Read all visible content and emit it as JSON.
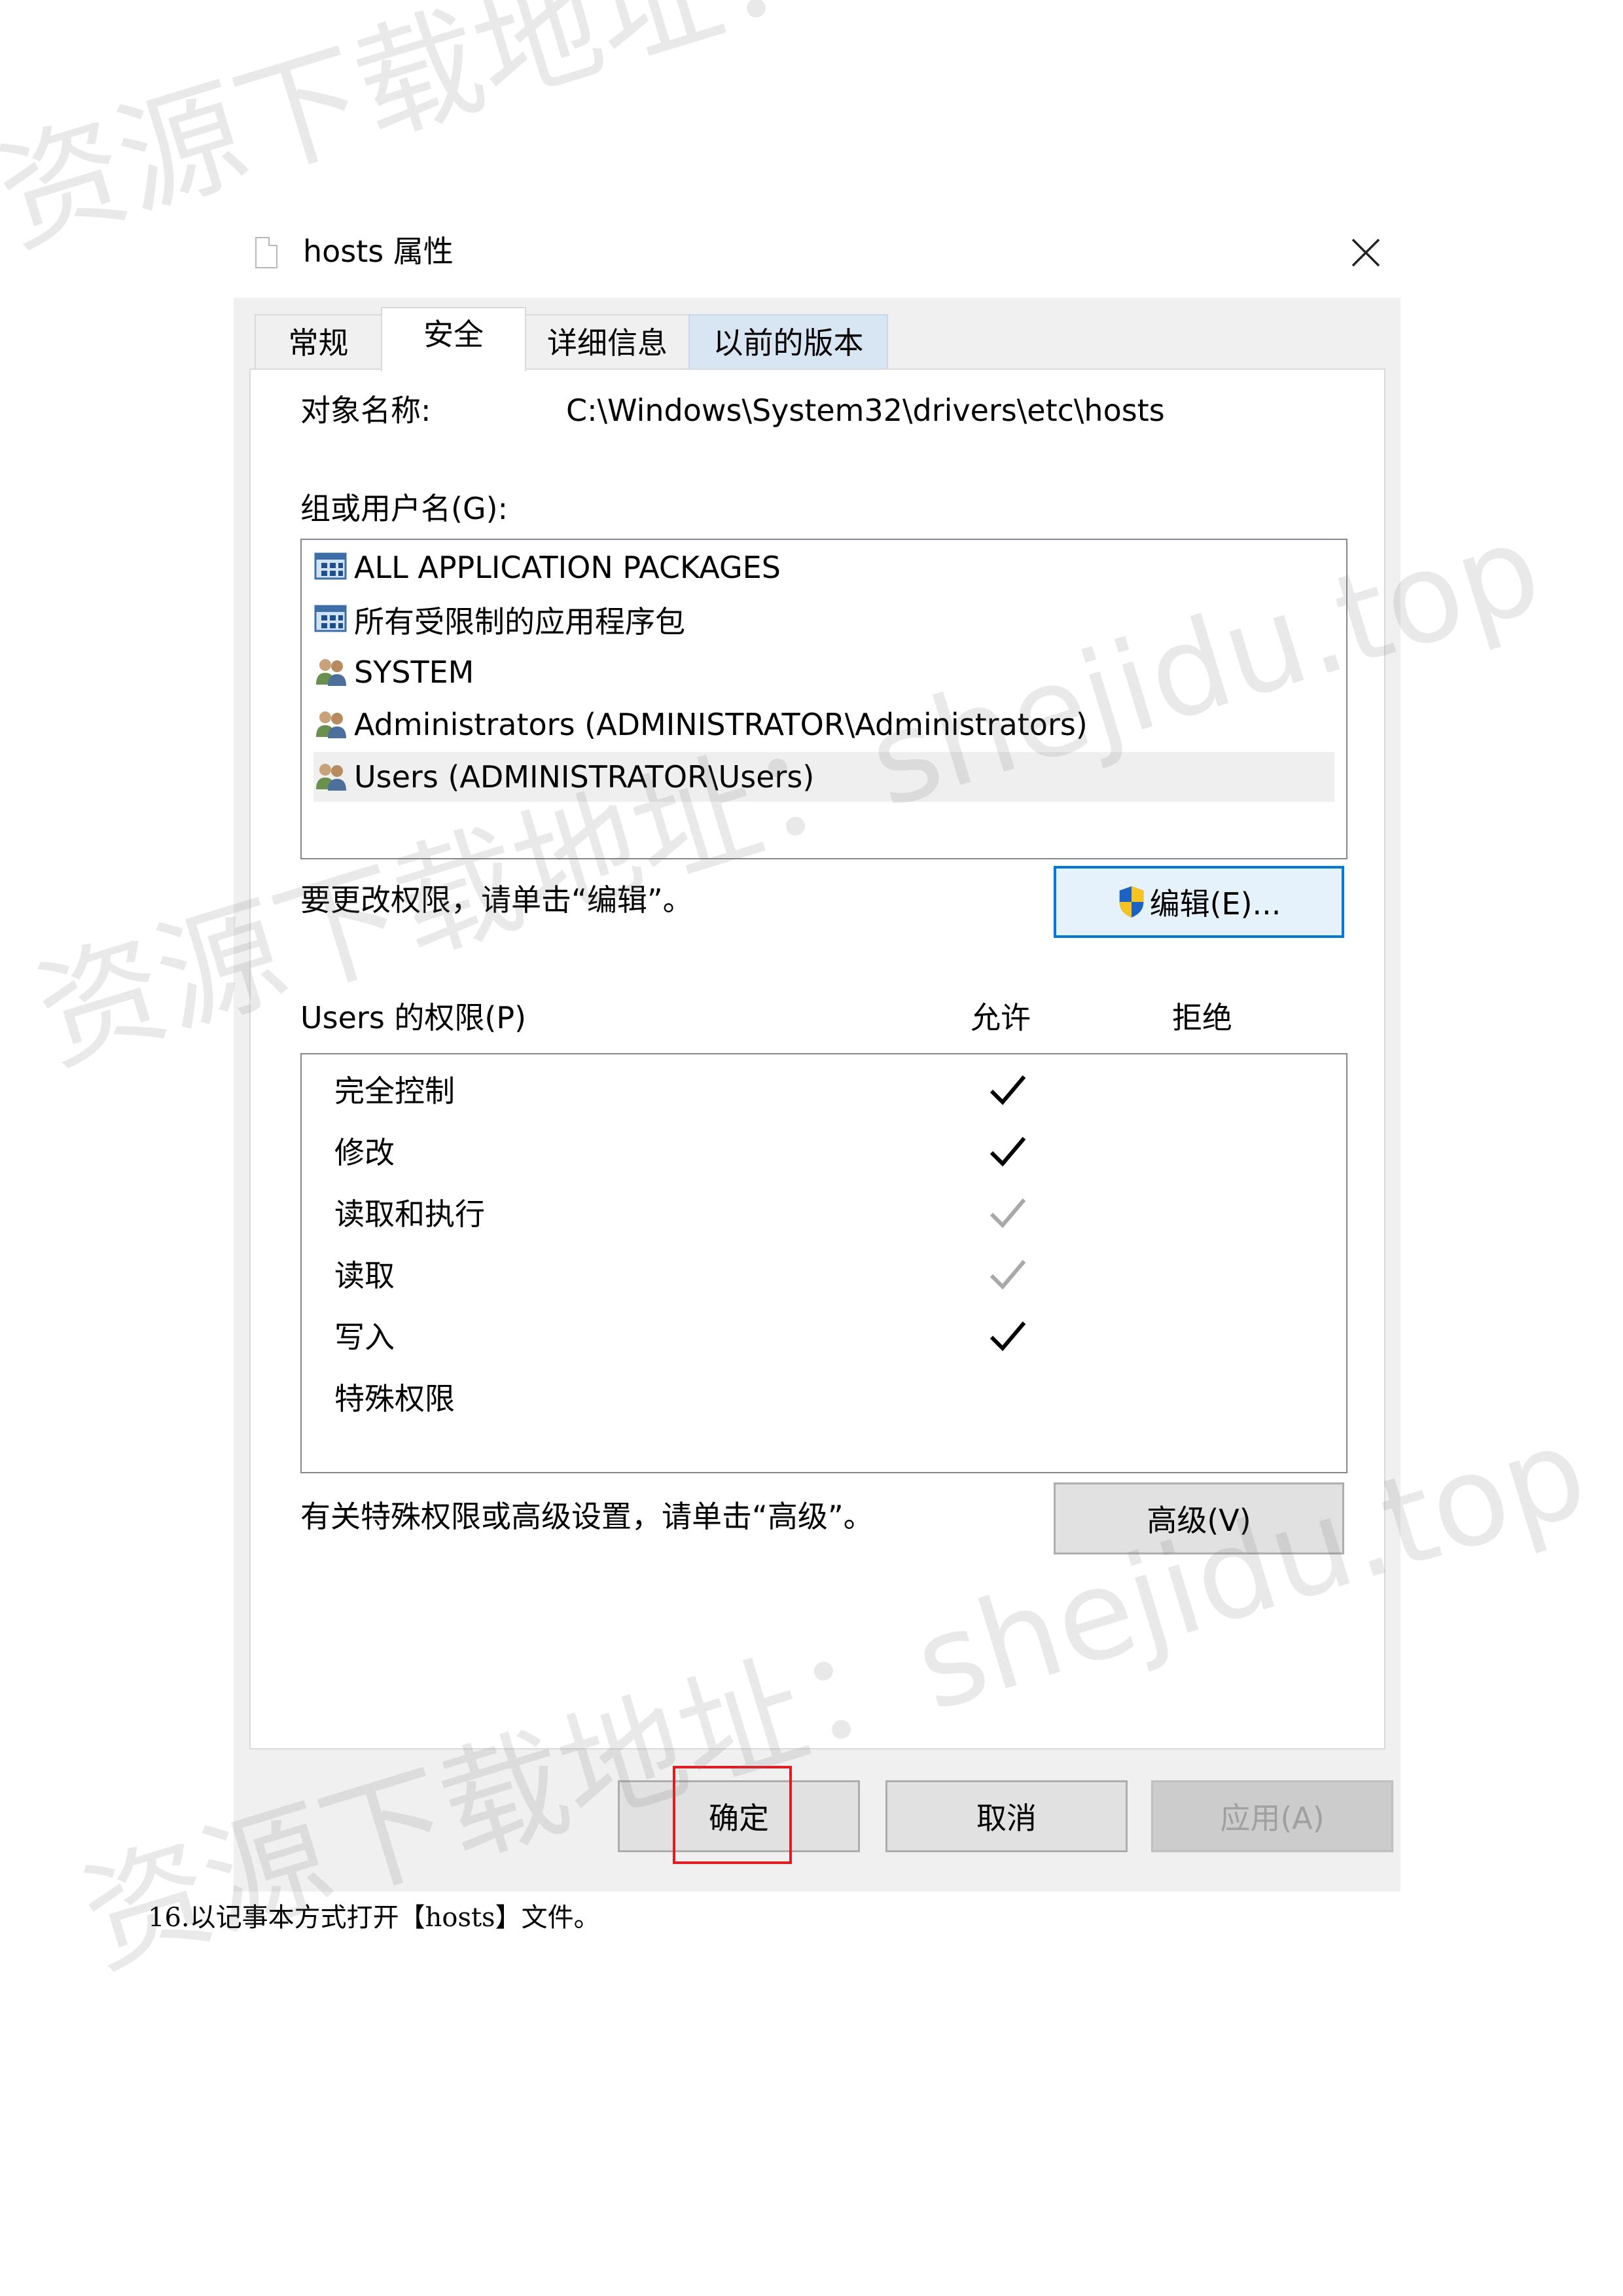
{
  "dialog": {
    "title": "hosts 属性",
    "tabs": [
      {
        "label": "常规"
      },
      {
        "label": "安全",
        "active": true
      },
      {
        "label": "详细信息"
      },
      {
        "label": "以前的版本"
      }
    ],
    "object_name_label": "对象名称:",
    "object_name_value": "C:\\Windows\\System32\\drivers\\etc\\hosts",
    "groups_label": "组或用户名(G):",
    "groups": [
      {
        "label": "ALL APPLICATION PACKAGES",
        "icon": "package-icon"
      },
      {
        "label": "所有受限制的应用程序包",
        "icon": "package-icon"
      },
      {
        "label": "SYSTEM",
        "icon": "users-icon"
      },
      {
        "label": "Administrators (ADMINISTRATOR\\Administrators)",
        "icon": "users-icon"
      },
      {
        "label": "Users (ADMINISTRATOR\\Users)",
        "icon": "users-icon",
        "selected": true
      }
    ],
    "change_hint": "要更改权限，请单击“编辑”。",
    "edit_button": "编辑(E)...",
    "permissions_label": "Users 的权限(P)",
    "allow_header": "允许",
    "deny_header": "拒绝",
    "permissions": [
      {
        "name": "完全控制",
        "allow": "black"
      },
      {
        "name": "修改",
        "allow": "black"
      },
      {
        "name": "读取和执行",
        "allow": "gray"
      },
      {
        "name": "读取",
        "allow": "gray"
      },
      {
        "name": "写入",
        "allow": "black"
      },
      {
        "name": "特殊权限",
        "allow": "none"
      }
    ],
    "advanced_hint": "有关特殊权限或高级设置，请单击“高级”。",
    "advanced_button": "高级(V)",
    "ok_button": "确定",
    "cancel_button": "取消",
    "apply_button": "应用(A)"
  },
  "caption": "16.以记事本方式打开【hosts】文件。",
  "watermarks": [
    {
      "text": "资源下载地址：shejidu.top"
    },
    {
      "text": "资源下载地址：shejidu.top"
    },
    {
      "text": "资源下载地址：shejidu.top"
    }
  ],
  "colors": {
    "focus_border": "#0078d7",
    "highlight_box": "#e01b22",
    "dialog_bg": "#f0f0f0"
  }
}
